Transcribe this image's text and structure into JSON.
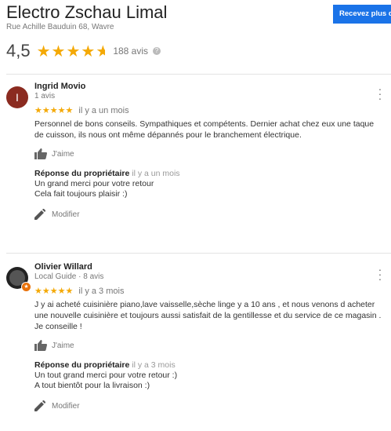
{
  "business": {
    "name": "Electro Zschau Limal",
    "address": "Rue Achille Bauduin 68, Wavre",
    "cta_label": "Recevez plus d'a",
    "rating": "4,5",
    "review_count": "188 avis",
    "stars": 4.5
  },
  "reviews": [
    {
      "author": "Ingrid Movio",
      "meta": "1 avis",
      "avatar_initial": "I",
      "stars": "★★★★★",
      "rating": 5,
      "date": "il y a un mois",
      "text": "Personnel de bons conseils. Sympathiques et compétents. Dernier achat chez eux une taque de cuisson, ils nous ont même dépannés pour le branchement électrique.",
      "like_label": "J'aime",
      "owner_title": "Réponse du propriétaire",
      "owner_date": "il y a un mois",
      "owner_line1": "Un grand merci pour votre retour",
      "owner_line2": "Cela fait toujours plaisir :)",
      "edit_label": "Modifier"
    },
    {
      "author": "Olivier Willard",
      "meta": "Local Guide · 8 avis",
      "stars": "★★★★★",
      "rating": 5,
      "date": "il y a 3 mois",
      "text_line1": "J y ai acheté cuisinière piano,lave vaisselle,sèche linge y a 10 ans , et nous venons d acheter une nouvelle cuisinière et toujours aussi satisfait de la gentillesse et du service de ce magasin .",
      "text_line2": "Je conseille !",
      "like_label": "J'aime",
      "owner_title": "Réponse du propriétaire",
      "owner_date": "il y a 3 mois",
      "owner_line1": "Un tout grand merci pour votre retour :)",
      "owner_line2": "A tout bientôt pour la livraison :)",
      "edit_label": "Modifier"
    }
  ],
  "colors": {
    "star": "#f4a906",
    "cta": "#1a73e8",
    "avatar_1": "#8b2b20"
  }
}
